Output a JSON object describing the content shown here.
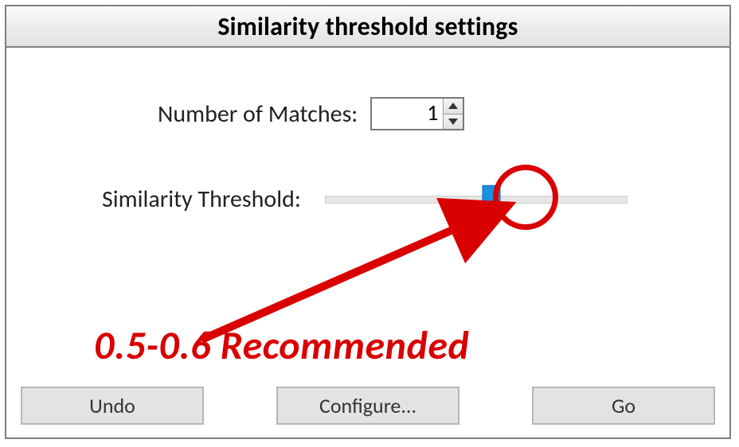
{
  "title": "Similarity threshold settings",
  "matches": {
    "label": "Number of Matches:",
    "value": "1"
  },
  "threshold": {
    "label": "Similarity Threshold:",
    "slider_position_percent": 55
  },
  "annotation": {
    "text": "0.5-0.6 Recommended"
  },
  "buttons": {
    "undo": "Undo",
    "configure": "Configure...",
    "go": "Go"
  }
}
